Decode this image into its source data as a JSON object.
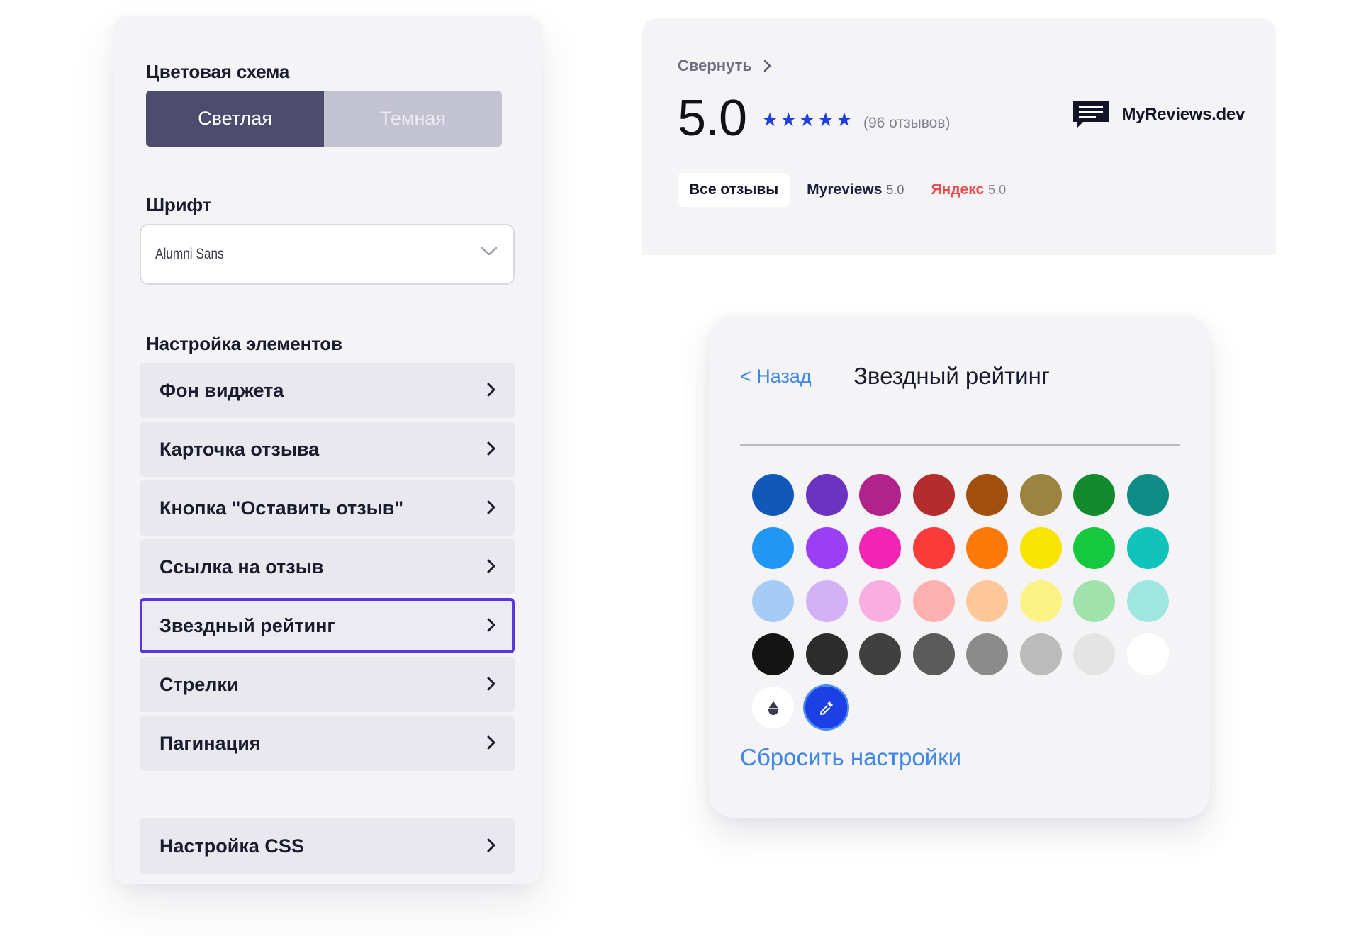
{
  "settings": {
    "color_scheme_title": "Цветовая схема",
    "scheme_options": [
      {
        "label": "Светлая",
        "active": true
      },
      {
        "label": "Темная",
        "active": false
      }
    ],
    "font_title": "Шрифт",
    "font_value": "Alumni Sans",
    "elements_title": "Настройка элементов",
    "menu_items": [
      {
        "label": "Фон виджета"
      },
      {
        "label": "Карточка отзыва"
      },
      {
        "label": "Кнопка \"Оставить отзыв\""
      },
      {
        "label": "Ссылка на отзыв"
      },
      {
        "label": "Звездный рейтинг",
        "selected": true
      },
      {
        "label": "Стрелки"
      },
      {
        "label": "Пагинация"
      }
    ],
    "css_item_label": "Настройка CSS"
  },
  "reviews_widget": {
    "collapse_label": "Свернуть",
    "rating": "5.0",
    "stars": 5,
    "review_count": "(96 отзывов)",
    "brand_name": "MyReviews.dev",
    "tabs": [
      {
        "label": "Все отзывы",
        "score": ""
      },
      {
        "label": "Myreviews",
        "score": "5.0"
      },
      {
        "label": "Яндекс",
        "score": "5.0"
      }
    ]
  },
  "color_panel": {
    "back_label": "< Назад",
    "title": "Звездный рейтинг",
    "reset_label": "Сбросить настройки",
    "swatch_rows": [
      [
        "#1159b8",
        "#6b34c0",
        "#b0238a",
        "#b52c2c",
        "#a14f0d",
        "#9a8440",
        "#138a2b",
        "#0f8c86"
      ],
      [
        "#2196f3",
        "#9b3ff5",
        "#f224b4",
        "#fb3a3a",
        "#fd7a0a",
        "#f8e400",
        "#15c83d",
        "#10c4bb"
      ],
      [
        "#a6cbf7",
        "#d4b1f6",
        "#f8aee1",
        "#fdb0b0",
        "#fdc79a",
        "#fbf283",
        "#9fe2ac",
        "#9fe6e2"
      ],
      [
        "#141414",
        "#2c2c2c",
        "#404040",
        "#5b5b5b",
        "#8b8b8b",
        "#bbbbbb",
        "#e4e4e4",
        "#ffffff"
      ]
    ]
  }
}
